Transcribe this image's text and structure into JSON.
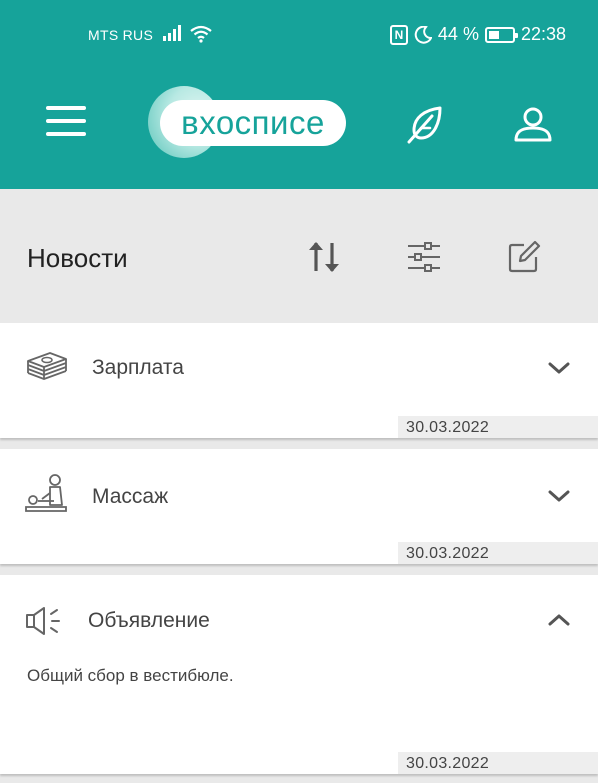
{
  "status_bar": {
    "carrier": "MTS RUS",
    "battery": "44 %",
    "battery_level": 0.44,
    "time": "22:38"
  },
  "header": {
    "logo_text": "вхосписе",
    "icons": [
      "menu-icon",
      "leaf-icon",
      "user-icon"
    ]
  },
  "toolbar": {
    "title": "Новости",
    "icons": [
      "sort-icon",
      "filter-icon",
      "edit-icon"
    ]
  },
  "news": [
    {
      "icon": "money-icon",
      "title": "Зарплата",
      "date": "30.03.2022",
      "expanded": false,
      "body": ""
    },
    {
      "icon": "massage-icon",
      "title": "Массаж",
      "date": "30.03.2022",
      "expanded": false,
      "body": ""
    },
    {
      "icon": "megaphone-icon",
      "title": "Объявление",
      "date": "30.03.2022",
      "expanded": true,
      "body": "Общий сбор в вестибюле."
    }
  ],
  "colors": {
    "primary": "#16a39a",
    "background": "#e9e9e9",
    "card": "#ffffff",
    "icon_gray": "#555555"
  }
}
